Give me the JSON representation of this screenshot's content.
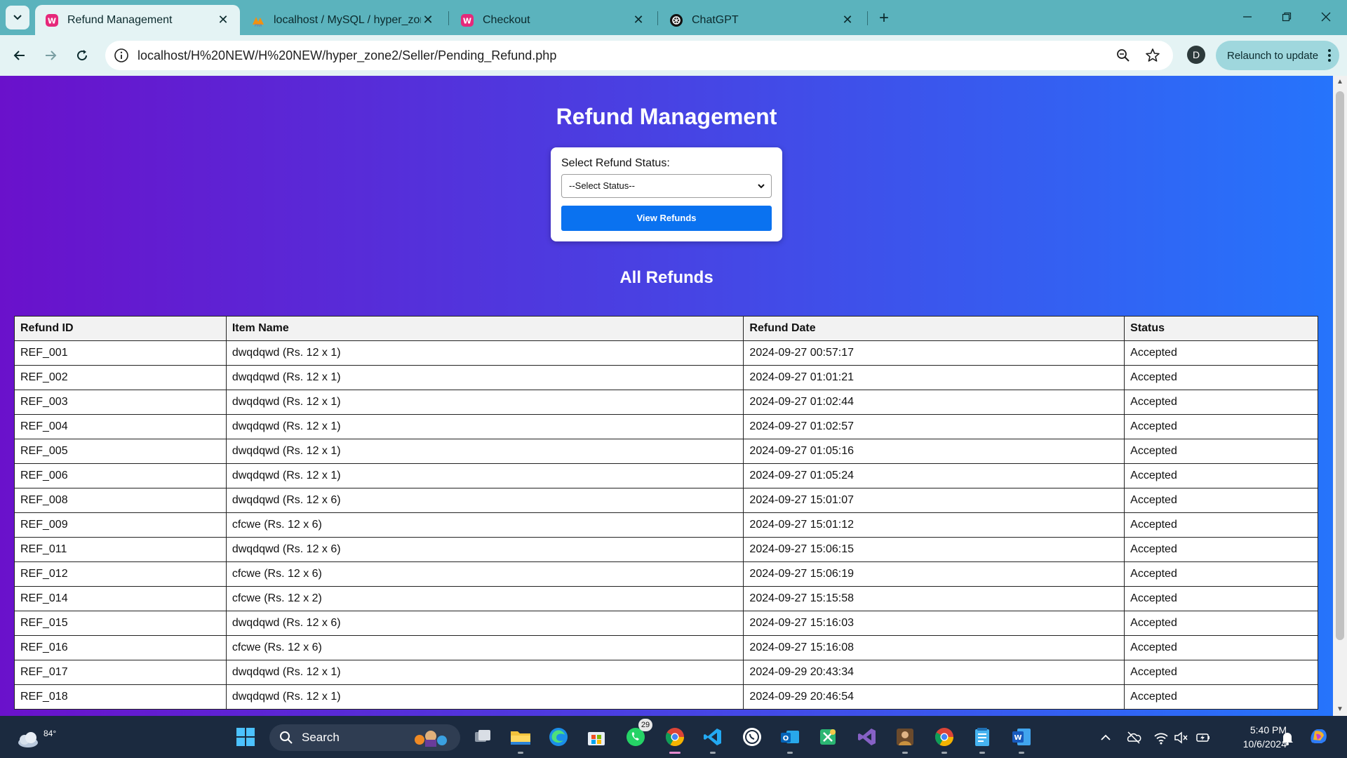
{
  "browser": {
    "tabs": [
      {
        "title": "Refund Management",
        "active": true
      },
      {
        "title": "localhost / MySQL / hyper_zone",
        "active": false
      },
      {
        "title": "Checkout",
        "active": false
      },
      {
        "title": "ChatGPT",
        "active": false
      }
    ],
    "url": "localhost/H%20NEW/H%20NEW/hyper_zone2/Seller/Pending_Refund.php",
    "profile_initial": "D",
    "relaunch_label": "Relaunch to update"
  },
  "page": {
    "title": "Refund Management",
    "filter": {
      "label": "Select Refund Status:",
      "selected": "--Select Status--",
      "button": "View Refunds"
    },
    "section_title": "All Refunds",
    "table": {
      "headers": [
        "Refund ID",
        "Item Name",
        "Refund Date",
        "Status"
      ],
      "rows": [
        [
          "REF_001",
          "dwqdqwd (Rs. 12 x 1)",
          "2024-09-27 00:57:17",
          "Accepted"
        ],
        [
          "REF_002",
          "dwqdqwd (Rs. 12 x 1)",
          "2024-09-27 01:01:21",
          "Accepted"
        ],
        [
          "REF_003",
          "dwqdqwd (Rs. 12 x 1)",
          "2024-09-27 01:02:44",
          "Accepted"
        ],
        [
          "REF_004",
          "dwqdqwd (Rs. 12 x 1)",
          "2024-09-27 01:02:57",
          "Accepted"
        ],
        [
          "REF_005",
          "dwqdqwd (Rs. 12 x 1)",
          "2024-09-27 01:05:16",
          "Accepted"
        ],
        [
          "REF_006",
          "dwqdqwd (Rs. 12 x 1)",
          "2024-09-27 01:05:24",
          "Accepted"
        ],
        [
          "REF_008",
          "dwqdqwd (Rs. 12 x 6)",
          "2024-09-27 15:01:07",
          "Accepted"
        ],
        [
          "REF_009",
          "cfcwe (Rs. 12 x 6)",
          "2024-09-27 15:01:12",
          "Accepted"
        ],
        [
          "REF_011",
          "dwqdqwd (Rs. 12 x 6)",
          "2024-09-27 15:06:15",
          "Accepted"
        ],
        [
          "REF_012",
          "cfcwe (Rs. 12 x 6)",
          "2024-09-27 15:06:19",
          "Accepted"
        ],
        [
          "REF_014",
          "cfcwe (Rs. 12 x 2)",
          "2024-09-27 15:15:58",
          "Accepted"
        ],
        [
          "REF_015",
          "dwqdqwd (Rs. 12 x 6)",
          "2024-09-27 15:16:03",
          "Accepted"
        ],
        [
          "REF_016",
          "cfcwe (Rs. 12 x 6)",
          "2024-09-27 15:16:08",
          "Accepted"
        ],
        [
          "REF_017",
          "dwqdqwd (Rs. 12 x 1)",
          "2024-09-29 20:43:34",
          "Accepted"
        ],
        [
          "REF_018",
          "dwqdqwd (Rs. 12 x 1)",
          "2024-09-29 20:46:54",
          "Accepted"
        ]
      ]
    }
  },
  "taskbar": {
    "weather_temp": "84°",
    "search_label": "Search",
    "whatsapp_badge": "29",
    "time": "5:40 PM",
    "date": "10/6/2024"
  },
  "colors": {
    "gradient_start": "#6a11cb",
    "gradient_end": "#2575fc",
    "button_blue": "#0a72f0",
    "chrome_teal": "#5bb3bd"
  }
}
